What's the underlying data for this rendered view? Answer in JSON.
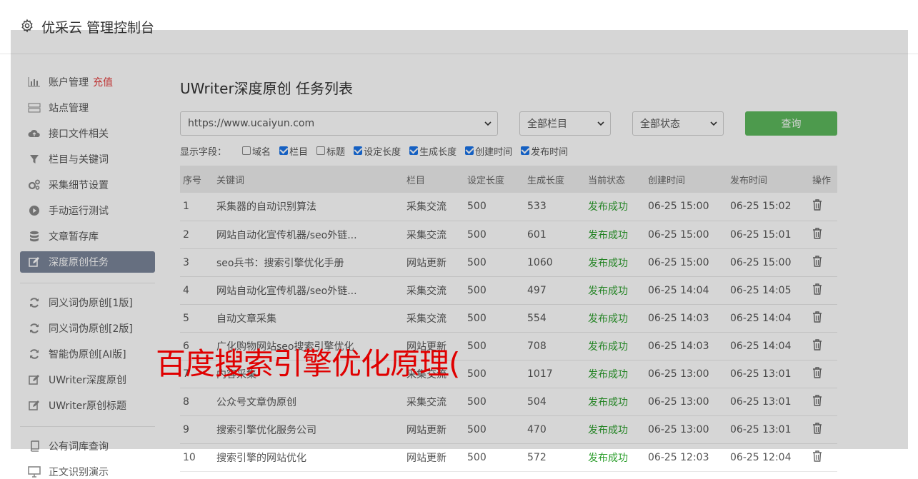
{
  "header": {
    "title": "优采云 管理控制台"
  },
  "sidebar": {
    "items": [
      {
        "label": "账户管理",
        "badge": "充值",
        "icon": "bar-chart-icon"
      },
      {
        "label": "站点管理",
        "icon": "server-icon"
      },
      {
        "label": "接口文件相关",
        "icon": "cloud-upload-icon"
      },
      {
        "label": "栏目与关键词",
        "icon": "filter-icon"
      },
      {
        "label": "采集细节设置",
        "icon": "gears-icon"
      },
      {
        "label": "手动运行测试",
        "icon": "play-circle-icon"
      },
      {
        "label": "文章暂存库",
        "icon": "database-icon"
      },
      {
        "label": "深度原创任务",
        "icon": "edit-icon",
        "active": true
      }
    ],
    "group2": [
      {
        "label": "同义词伪原创[1版]",
        "icon": "refresh-icon"
      },
      {
        "label": "同义词伪原创[2版]",
        "icon": "refresh-icon"
      },
      {
        "label": "智能伪原创[AI版]",
        "icon": "refresh-icon"
      },
      {
        "label": "UWriter深度原创",
        "icon": "edit-icon"
      },
      {
        "label": "UWriter原创标题",
        "icon": "edit-icon"
      }
    ],
    "group3": [
      {
        "label": "公有词库查询",
        "icon": "book-icon"
      },
      {
        "label": "正文识别演示",
        "icon": "monitor-icon"
      }
    ]
  },
  "main": {
    "title": "UWriter深度原创 任务列表",
    "site_select": "https://www.ucaiyun.com",
    "column_select": "全部栏目",
    "status_select": "全部状态",
    "query_button": "查询",
    "fields_label": "显示字段：",
    "fields": [
      {
        "label": "域名",
        "checked": false
      },
      {
        "label": "栏目",
        "checked": true
      },
      {
        "label": "标题",
        "checked": false
      },
      {
        "label": "设定长度",
        "checked": true
      },
      {
        "label": "生成长度",
        "checked": true
      },
      {
        "label": "创建时间",
        "checked": true
      },
      {
        "label": "发布时间",
        "checked": true
      }
    ],
    "table": {
      "headers": [
        "序号",
        "关键词",
        "栏目",
        "设定长度",
        "生成长度",
        "当前状态",
        "创建时间",
        "发布时间",
        "操作"
      ],
      "rows": [
        [
          "1",
          "采集器的自动识别算法",
          "采集交流",
          "500",
          "533",
          "发布成功",
          "06-25 15:00",
          "06-25 15:02"
        ],
        [
          "2",
          "网站自动化宣传机器/seo外链...",
          "采集交流",
          "500",
          "601",
          "发布成功",
          "06-25 15:00",
          "06-25 15:01"
        ],
        [
          "3",
          "seo兵书：搜索引擎优化手册",
          "网站更新",
          "500",
          "1060",
          "发布成功",
          "06-25 15:00",
          "06-25 15:00"
        ],
        [
          "4",
          "网站自动化宣传机器/seo外链...",
          "采集交流",
          "500",
          "497",
          "发布成功",
          "06-25 14:04",
          "06-25 14:05"
        ],
        [
          "5",
          "自动文章采集",
          "采集交流",
          "500",
          "554",
          "发布成功",
          "06-25 14:03",
          "06-25 14:04"
        ],
        [
          "6",
          "广化购物网站seo搜索引擎优化",
          "网站更新",
          "500",
          "708",
          "发布成功",
          "06-25 14:03",
          "06-25 14:04"
        ],
        [
          "7",
          "内容采集",
          "采集交流",
          "500",
          "1017",
          "发布成功",
          "06-25 13:00",
          "06-25 13:01"
        ],
        [
          "8",
          "公众号文章伪原创",
          "采集交流",
          "500",
          "504",
          "发布成功",
          "06-25 13:00",
          "06-25 13:01"
        ],
        [
          "9",
          "搜索引擎优化服务公司",
          "网站更新",
          "500",
          "470",
          "发布成功",
          "06-25 13:00",
          "06-25 13:01"
        ],
        [
          "10",
          "搜索引擎的网站优化",
          "网站更新",
          "500",
          "572",
          "发布成功",
          "06-25 12:03",
          "06-25 12:04"
        ]
      ]
    }
  },
  "watermark": "百度搜索引擎优化原理(",
  "colors": {
    "query_button": "#5cb85c",
    "active_item": "#7a8599",
    "status_ok": "#2a9d2a",
    "recharge": "#e23b3b",
    "watermark": "#e00000"
  }
}
